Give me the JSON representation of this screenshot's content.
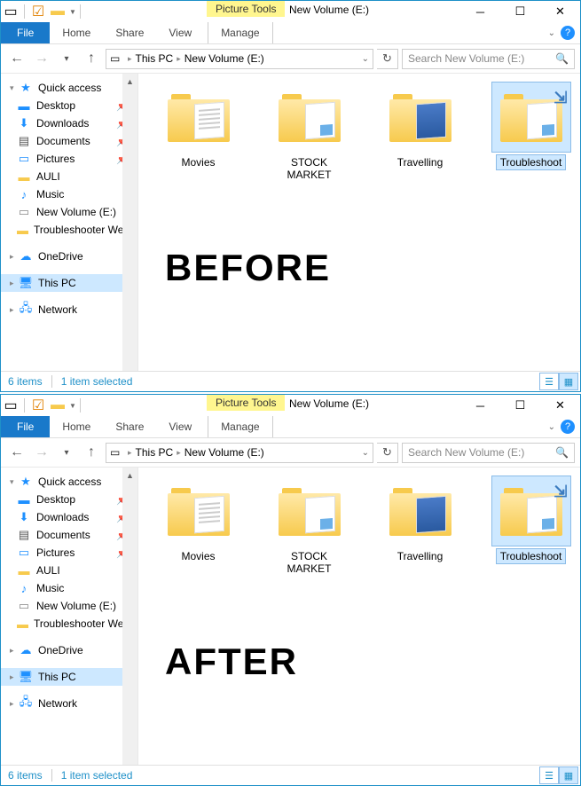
{
  "window_title": "New Volume (E:)",
  "picture_tools_label": "Picture Tools",
  "tabs": {
    "file": "File",
    "home": "Home",
    "share": "Share",
    "view": "View",
    "manage": "Manage"
  },
  "breadcrumb": {
    "root": "This PC",
    "current": "New Volume (E:)"
  },
  "search_placeholder": "Search New Volume (E:)",
  "nav": {
    "quick_access": "Quick access",
    "items": [
      {
        "label": "Desktop",
        "pinned": true
      },
      {
        "label": "Downloads",
        "pinned": true
      },
      {
        "label": "Documents",
        "pinned": true
      },
      {
        "label": "Pictures",
        "pinned": true
      },
      {
        "label": "AULI",
        "pinned": false
      },
      {
        "label": "Music",
        "pinned": false
      },
      {
        "label": "New Volume (E:)",
        "pinned": false
      },
      {
        "label": "Troubleshooter Website",
        "pinned": false
      }
    ],
    "onedrive": "OneDrive",
    "this_pc": "This PC",
    "network": "Network"
  },
  "folders": [
    {
      "label": "Movies"
    },
    {
      "label": "STOCK MARKET"
    },
    {
      "label": "Travelling"
    },
    {
      "label": "Troubleshoot"
    }
  ],
  "status": {
    "items": "6 items",
    "selected": "1 item selected"
  },
  "overlay": {
    "before": "BEFORE",
    "after": "AFTER"
  }
}
